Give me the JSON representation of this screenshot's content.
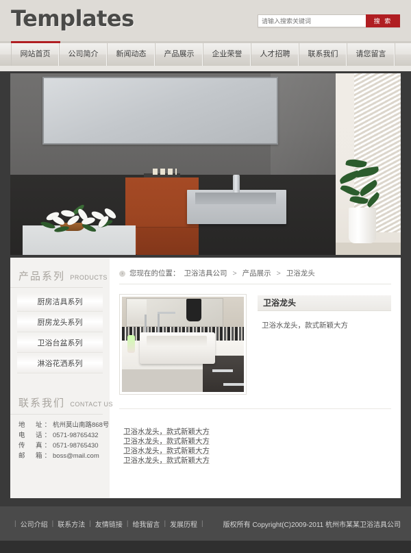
{
  "header": {
    "logo": "Templates",
    "search": {
      "placeholder": "请输入搜索关键词",
      "value": "",
      "button_label": "搜 索"
    }
  },
  "nav": {
    "items": [
      {
        "label": "网站首页",
        "active": true
      },
      {
        "label": "公司简介",
        "active": false
      },
      {
        "label": "新闻动态",
        "active": false
      },
      {
        "label": "产品展示",
        "active": false
      },
      {
        "label": "企业荣誉",
        "active": false
      },
      {
        "label": "人才招聘",
        "active": false
      },
      {
        "label": "联系我们",
        "active": false
      },
      {
        "label": "请您留言",
        "active": false
      }
    ]
  },
  "banner": {
    "alt": "现代卫浴展示间 — 壁挂洗手盆、木质柜体、百合花与绿植"
  },
  "sidebar": {
    "products": {
      "title_cn": "产品系列",
      "title_en": "PRODUCTS",
      "items": [
        {
          "label": "厨房洁具系列"
        },
        {
          "label": "厨房龙头系列"
        },
        {
          "label": "卫浴台盆系列"
        },
        {
          "label": "淋浴花洒系列"
        }
      ]
    },
    "contact": {
      "title_cn": "联系我们",
      "title_en": "CONTACT US",
      "lines": [
        {
          "label": "地　址：",
          "value": "杭州莫山南路868号"
        },
        {
          "label": "电　话：",
          "value": "0571-98765432"
        },
        {
          "label": "传　真：",
          "value": "0571-98765430"
        },
        {
          "label": "邮　箱：",
          "value": "boss@mail.com"
        }
      ]
    }
  },
  "main": {
    "breadcrumb": {
      "prefix": "您现在的位置：",
      "items": [
        "卫浴洁具公司",
        "产品展示",
        "卫浴龙头"
      ],
      "separator": ">"
    },
    "product": {
      "title": "卫浴龙头",
      "description": "卫浴水龙头，款式新颖大方",
      "image_alt": "白色方形台上盆与镀铬龙头"
    },
    "extra_lines": [
      "卫浴水龙头，款式新颖大方",
      "卫浴水龙头，款式新颖大方",
      "卫浴水龙头，款式新颖大方",
      "卫浴水龙头，款式新颖大方"
    ]
  },
  "footer": {
    "links": [
      "公司介绍",
      "联系方法",
      "友情链接",
      "给我留言",
      "发展历程"
    ],
    "copyright": "版权所有  Copyright(C)2009-2011 杭州市某某卫浴洁具公司"
  },
  "colors": {
    "accent_red": "#b01e22",
    "header_bg": "#dedbd6",
    "page_bg": "#3a3a3a",
    "footer_bg": "#4a4a4a"
  }
}
